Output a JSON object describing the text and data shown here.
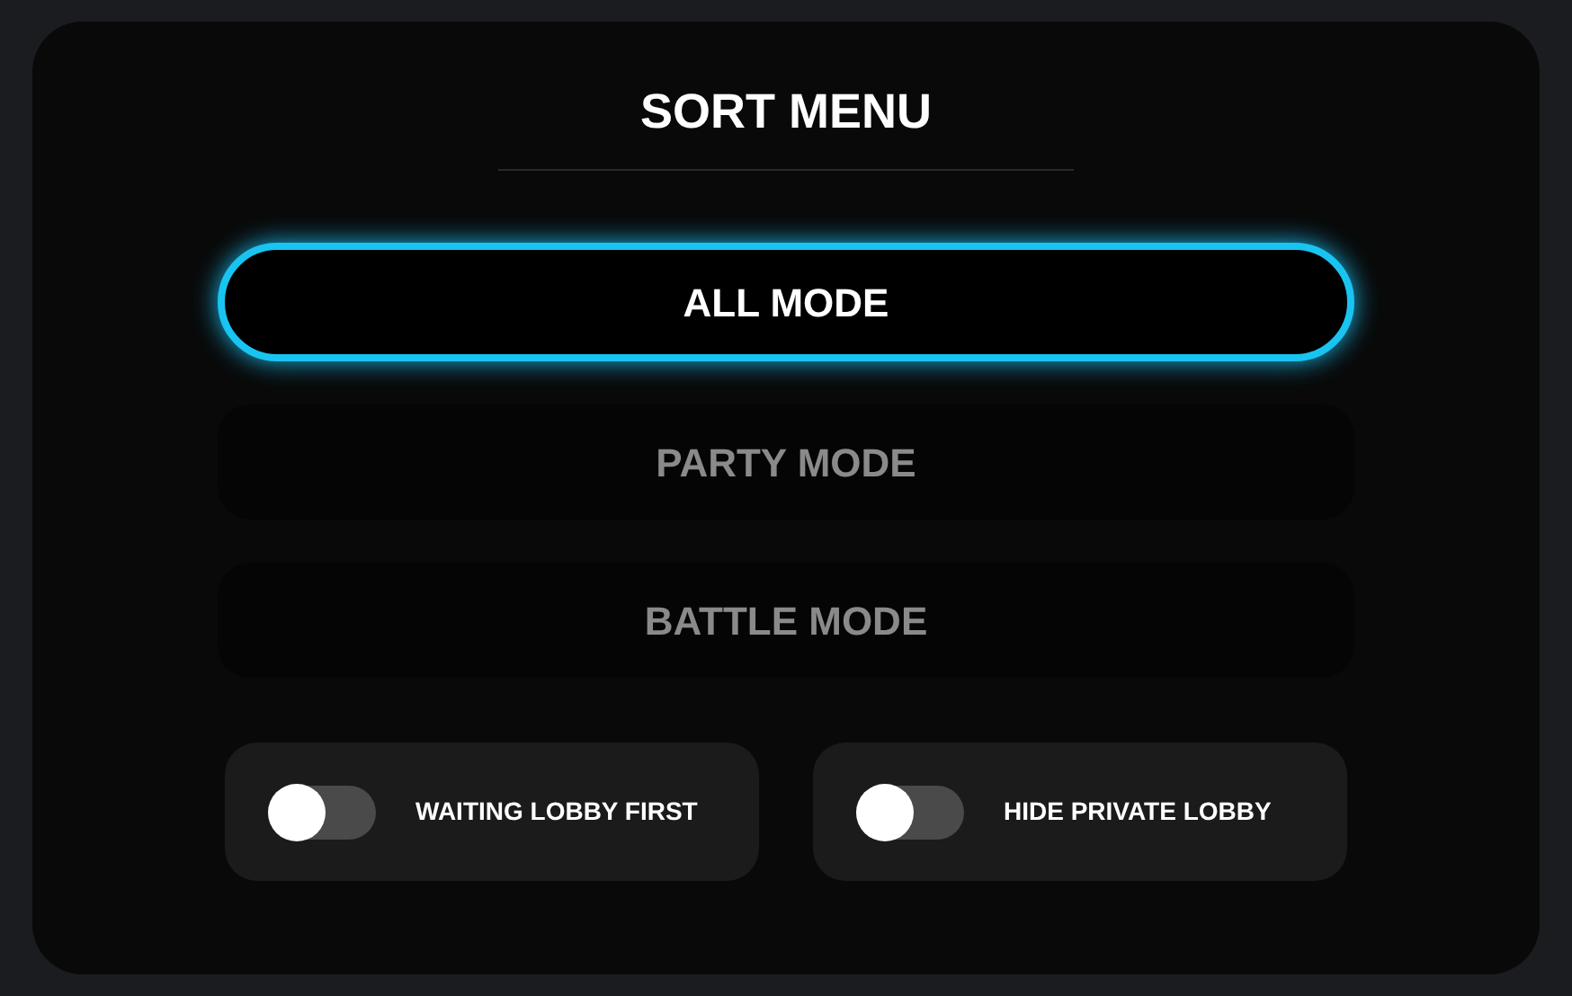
{
  "title": "SORT MENU",
  "modes": [
    {
      "label": "ALL MODE",
      "selected": true
    },
    {
      "label": "PARTY MODE",
      "selected": false
    },
    {
      "label": "BATTLE MODE",
      "selected": false
    }
  ],
  "toggles": [
    {
      "label": "WAITING LOBBY FIRST",
      "on": false
    },
    {
      "label": "HIDE PRIVATE LOBBY",
      "on": false
    }
  ]
}
